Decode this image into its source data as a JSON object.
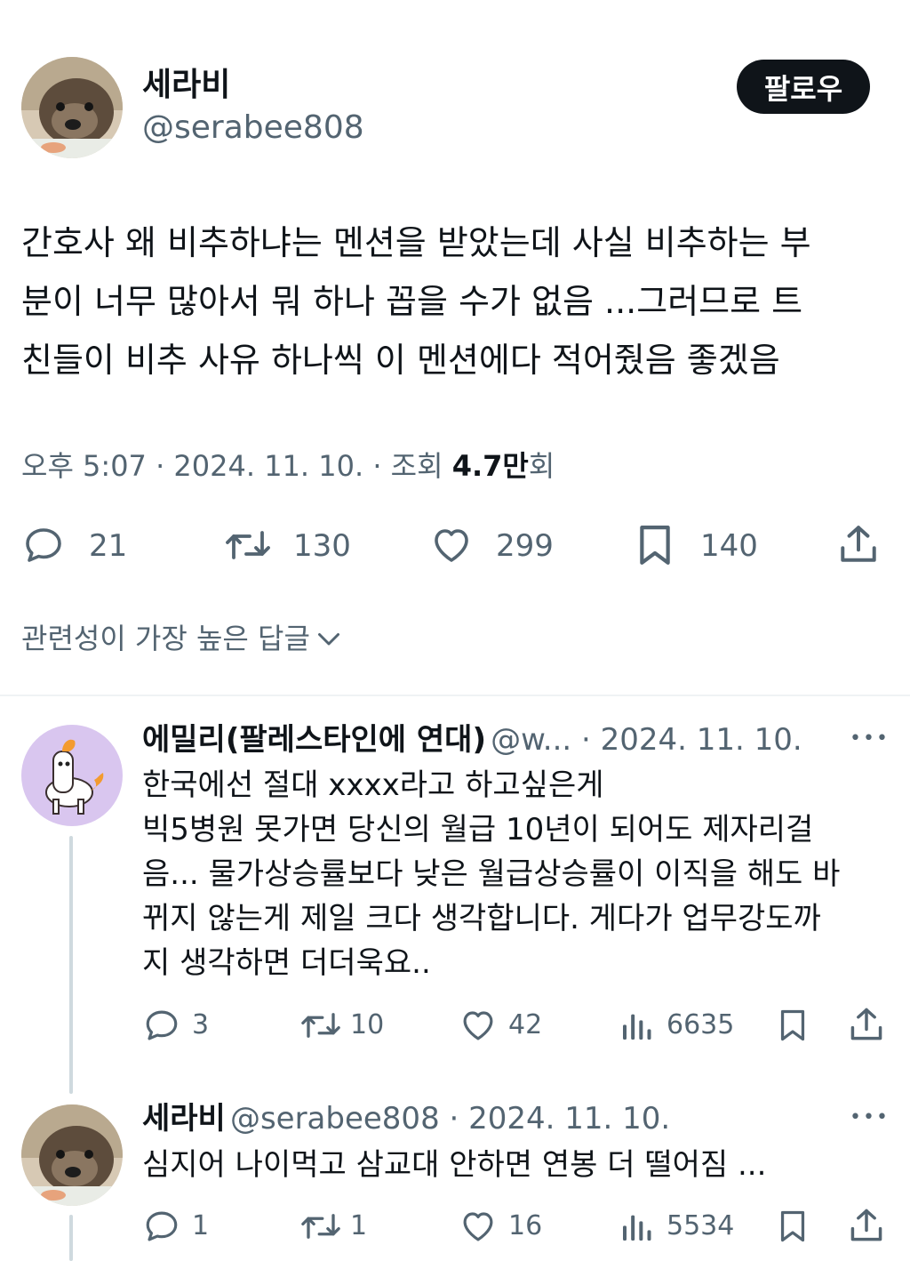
{
  "colors": {
    "text": "#0f1419",
    "secondary": "#536471",
    "follow_bg": "#0f1419",
    "divider": "#eff3f4",
    "thread_line": "#cfd9de"
  },
  "main_tweet": {
    "display_name": "세라비",
    "handle": "@serabee808",
    "follow_label": "팔로우",
    "lines": [
      "간호사 왜 비추하냐는 멘션을 받았는데 사실 비추하는 부",
      "분이 너무 많아서 뭐 하나 꼽을 수가 없음 ...그러므로 트",
      "친들이 비추 사유 하나씩 이 멘션에다 적어줬음 좋겠음"
    ],
    "time": "오후 5:07 · 2024. 11. 10. · 조회 ",
    "views": "4.7만",
    "views_suffix": "회",
    "replies": "21",
    "retweets": "130",
    "likes": "299",
    "bookmarks": "140",
    "icons": [
      "reply-icon",
      "retweet-icon",
      "like-icon",
      "bookmark-icon",
      "share-icon"
    ]
  },
  "sort": {
    "label": "관련성이 가장 높은 답글"
  },
  "replies": [
    {
      "name": "에밀리(팔레스타인에 연대)",
      "meta": "@w... · 2024. 11. 10.",
      "more": "•••",
      "lines": [
        "한국에선 절대 xxxx라고 하고싶은게",
        "빅5병원 못가면 당신의 월급 10년이 되어도 제자리걸",
        "음... 물가상승률보다 낮은 월급상승률이 이직을 해도 바",
        "뀌지 않는게 제일 크다 생각합니다. 게다가 업무강도까",
        "지 생각하면 더더욱요.."
      ],
      "replies": "3",
      "retweets": "10",
      "likes": "42",
      "views": "6635"
    },
    {
      "name": "세라비",
      "meta": "@serabee808 · 2024. 11. 10.",
      "more": "•••",
      "lines": [
        "심지어 나이먹고 삼교대 안하면 연봉 더 떨어짐 ..."
      ],
      "replies": "1",
      "retweets": "1",
      "likes": "16",
      "views": "5534"
    }
  ]
}
